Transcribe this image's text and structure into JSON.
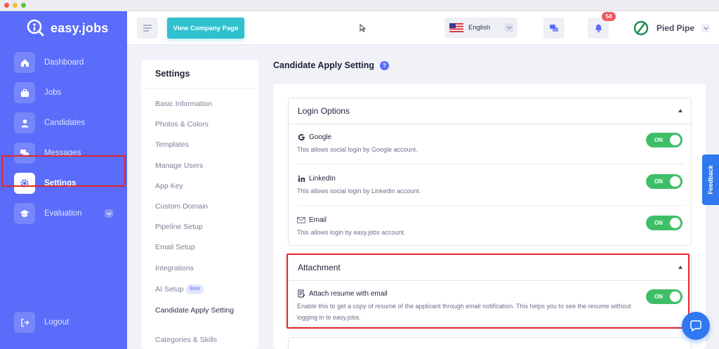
{
  "app": {
    "brand": "easy.jobs",
    "brand_color": "#5a6cf9"
  },
  "sidebar": {
    "items": [
      {
        "label": "Dashboard",
        "icon": "home-icon"
      },
      {
        "label": "Jobs",
        "icon": "briefcase-icon"
      },
      {
        "label": "Candidates",
        "icon": "user-icon"
      },
      {
        "label": "Messages",
        "icon": "chat-icon"
      },
      {
        "label": "Settings",
        "icon": "gear-icon",
        "active": true
      },
      {
        "label": "Evaluation",
        "icon": "graduation-cap-icon"
      }
    ],
    "logout": "Logout"
  },
  "topbar": {
    "view_company_label": "View Company Page",
    "language": "English",
    "notification_count": "54",
    "company_name": "Pied Pipe"
  },
  "settings_menu": {
    "title": "Settings",
    "items": [
      "Basic Information",
      "Photos & Colors",
      "Templates",
      "Manage Users",
      "App Key",
      "Custom Domain",
      "Pipeline Setup",
      "Email Setup",
      "Integrations",
      "AI Setup",
      "Candidate Apply Setting",
      "Categories & Skills"
    ],
    "beta_label": "Beta"
  },
  "main": {
    "title": "Candidate Apply Setting",
    "login_options": {
      "heading": "Login Options",
      "options": [
        {
          "title": "Google",
          "desc": "This allows social login by Google account.",
          "toggle": "ON"
        },
        {
          "title": "LinkedIn",
          "desc": "This allows social login by Linkedin account.",
          "toggle": "ON"
        },
        {
          "title": "Email",
          "desc": "This allows login by easy.jobs account.",
          "toggle": "ON"
        }
      ]
    },
    "attachment": {
      "heading": "Attachment",
      "option": {
        "title": "Attach resume with email",
        "desc": "Enable this to get a copy of resume of the applicant through email notification. This helps you to see the resume without logging in to easy.jobs.",
        "toggle": "ON"
      }
    }
  },
  "feedback_label": "Feedback",
  "colors": {
    "toggle_on": "#3fbe68",
    "accent_teal": "#2fc1cf",
    "highlight_red": "#e4262a"
  }
}
